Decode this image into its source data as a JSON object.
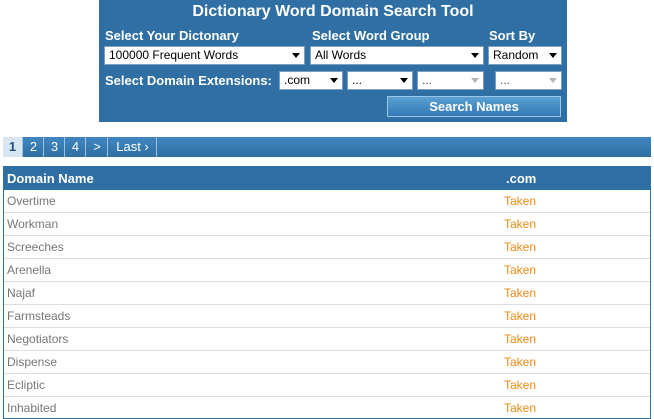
{
  "tool": {
    "title": "Dictionary Word Domain Search Tool",
    "dictionary_label": "Select Your Dictonary",
    "dictionary_value": "100000 Frequent Words",
    "word_group_label": "Select Word Group",
    "word_group_value": "All Words",
    "sort_label": "Sort By",
    "sort_value": "Random",
    "extensions_label": "Select Domain Extensions:",
    "ext1_value": ".com",
    "ext2_value": "...",
    "ext3_value": "...",
    "ext4_value": "...",
    "search_button": "Search Names"
  },
  "pager": {
    "pages": [
      "1",
      "2",
      "3",
      "4"
    ],
    "next": ">",
    "last": "Last ›"
  },
  "table": {
    "col_name": "Domain Name",
    "col_ext": ".com",
    "rows": [
      {
        "name": "Overtime",
        "status": "Taken"
      },
      {
        "name": "Workman",
        "status": "Taken"
      },
      {
        "name": "Screeches",
        "status": "Taken"
      },
      {
        "name": "Arenella",
        "status": "Taken"
      },
      {
        "name": "Najaf",
        "status": "Taken"
      },
      {
        "name": "Farmsteads",
        "status": "Taken"
      },
      {
        "name": "Negotiators",
        "status": "Taken"
      },
      {
        "name": "Dispense",
        "status": "Taken"
      },
      {
        "name": "Ecliptic",
        "status": "Taken"
      },
      {
        "name": "Inhabited",
        "status": "Taken"
      }
    ]
  },
  "colors": {
    "panel_blue": "#2f6fa3",
    "taken_orange": "#f08a14",
    "domain_gray": "#777777"
  }
}
